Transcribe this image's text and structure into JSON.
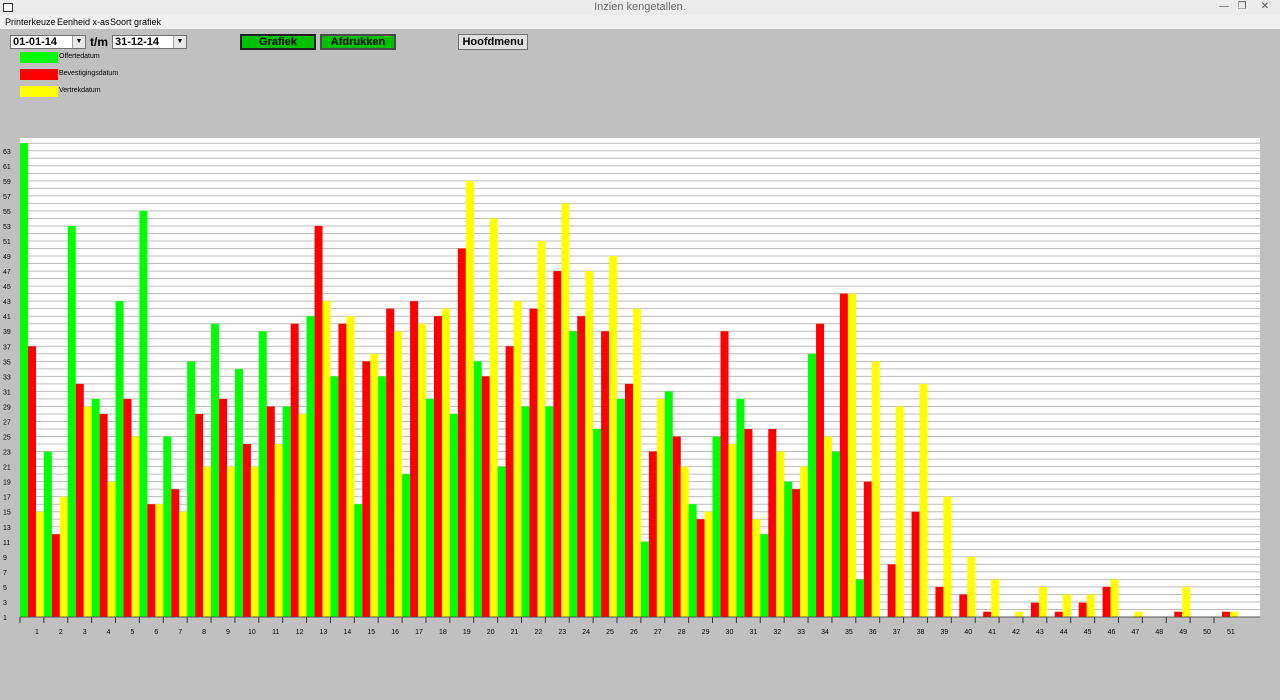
{
  "window": {
    "title": "Inzien kengetallen.",
    "restore_glyph": "❐",
    "close_glyph": "✕"
  },
  "menu": {
    "items": [
      "Printerkeuze",
      "Eenheid x-as",
      "Soort grafiek"
    ]
  },
  "toolbar": {
    "from_date": "01-01-14",
    "separator": "t/m",
    "to_date": "31-12-14",
    "grafiek_label": "Grafiek",
    "afdrukken_label": "Afdrukken",
    "hoofdmenu_label": "Hoofdmenu",
    "combo_arrow": "▼"
  },
  "colors": {
    "green": "#00ff00",
    "red": "#ff0000",
    "yellow": "#ffff00",
    "button_green": "#00c000",
    "background": "#c0c0c0"
  },
  "chart_data": {
    "type": "bar",
    "legend_position": "top-left",
    "grid": true,
    "ylim": [
      1,
      64
    ],
    "yticks": [
      1,
      3,
      5,
      7,
      9,
      11,
      13,
      15,
      17,
      19,
      21,
      23,
      25,
      27,
      29,
      31,
      33,
      35,
      37,
      39,
      41,
      43,
      45,
      47,
      49,
      51,
      53,
      55,
      57,
      59,
      61,
      63
    ],
    "categories": [
      "1",
      "2",
      "3",
      "4",
      "5",
      "6",
      "7",
      "8",
      "9",
      "10",
      "11",
      "12",
      "13",
      "14",
      "15",
      "16",
      "17",
      "18",
      "19",
      "20",
      "21",
      "22",
      "23",
      "24",
      "25",
      "26",
      "27",
      "28",
      "29",
      "30",
      "31",
      "32",
      "33",
      "34",
      "35",
      "36",
      "37",
      "38",
      "39",
      "40",
      "41",
      "42",
      "43",
      "44",
      "45",
      "46",
      "47",
      "48",
      "49",
      "50",
      "51"
    ],
    "series": [
      {
        "name": "Offertedatum",
        "color": "#00ff00",
        "values": [
          64,
          23,
          53,
          30,
          43,
          55,
          25,
          35,
          40,
          34,
          39,
          29,
          41,
          33,
          16,
          33,
          20,
          30,
          28,
          35,
          21,
          29,
          29,
          39,
          26,
          30,
          11,
          31,
          16,
          25,
          30,
          12,
          19,
          36,
          23,
          6,
          0,
          0,
          0,
          0,
          0,
          0,
          0,
          0,
          0,
          0,
          0,
          0,
          0,
          0,
          0
        ]
      },
      {
        "name": "Bevestigingsdatum",
        "color": "#ff0000",
        "values": [
          37,
          12,
          32,
          28,
          30,
          16,
          18,
          28,
          30,
          24,
          29,
          40,
          53,
          40,
          35,
          42,
          43,
          41,
          50,
          33,
          37,
          42,
          47,
          41,
          39,
          32,
          23,
          25,
          14,
          39,
          26,
          26,
          18,
          40,
          44,
          19,
          8,
          15,
          5,
          4,
          1.7,
          0,
          2.9,
          1.7,
          2.9,
          5,
          0.1,
          0.1,
          1.7,
          0.2,
          1.7
        ]
      },
      {
        "name": "Vertrekdatum",
        "color": "#ffff00",
        "values": [
          15,
          17,
          29,
          19,
          25,
          16,
          15,
          21,
          21,
          21,
          24,
          28,
          43,
          41,
          36,
          39,
          40,
          42,
          59,
          54,
          43,
          51,
          56,
          47,
          49,
          42,
          30,
          21,
          15,
          24,
          14,
          23,
          21,
          25,
          44,
          35,
          29,
          32,
          17,
          9,
          6,
          1.7,
          5,
          4,
          4,
          6,
          1.7,
          0.1,
          5,
          0,
          1.7
        ]
      }
    ]
  }
}
